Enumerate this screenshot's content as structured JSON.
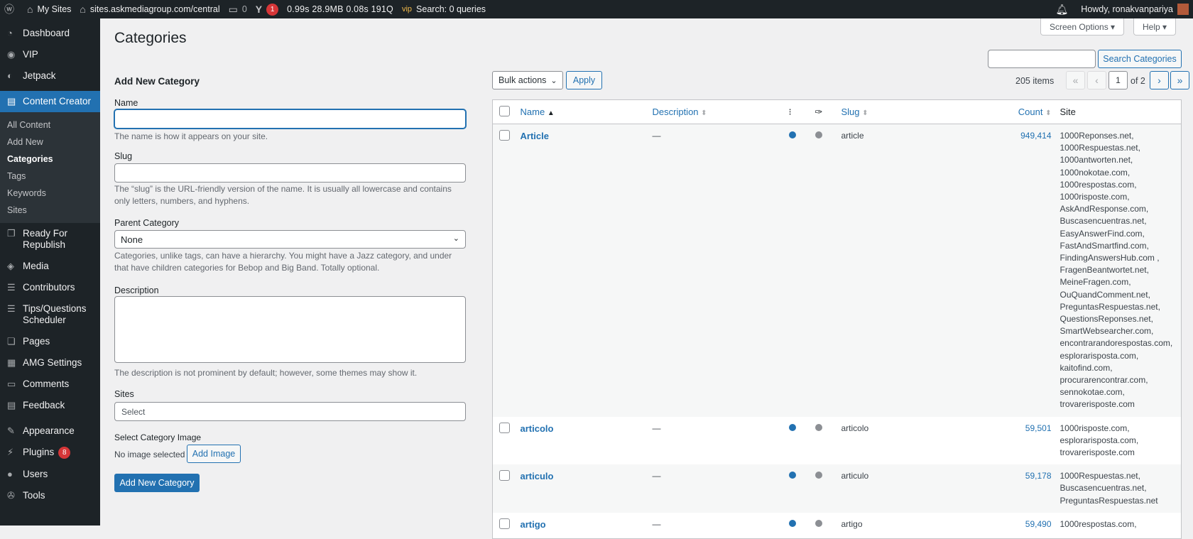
{
  "admin_bar": {
    "my_sites": "My Sites",
    "site_url": "sites.askmediagroup.com/central",
    "comments_count": "0",
    "yoast_count": "1",
    "perf": "0.99s  28.9MB  0.08s  191Q",
    "vip_search": "Search: 0 queries",
    "greeting": "Howdy, ronakvanpariya"
  },
  "sidebar": {
    "items_top": [
      "Dashboard",
      "VIP",
      "Jetpack"
    ],
    "active": "Content Creator",
    "submenu": [
      "All Content",
      "Add New",
      "Categories",
      "Tags",
      "Keywords",
      "Sites"
    ],
    "items_bottom": [
      "Ready For Republish",
      "Media",
      "Contributors",
      "Tips/Questions Scheduler",
      "Pages",
      "AMG Settings",
      "Comments",
      "Feedback",
      "Appearance",
      "Plugins",
      "Users",
      "Tools"
    ],
    "plugins_badge": "8"
  },
  "page": {
    "title": "Categories",
    "screen_options": "Screen Options ▾",
    "help": "Help ▾",
    "search_button": "Search Categories"
  },
  "form": {
    "heading": "Add New Category",
    "name_label": "Name",
    "name_help": "The name is how it appears on your site.",
    "slug_label": "Slug",
    "slug_help": "The “slug” is the URL-friendly version of the name. It is usually all lowercase and contains only letters, numbers, and hyphens.",
    "parent_label": "Parent Category",
    "parent_value": "None",
    "parent_help": "Categories, unlike tags, can have a hierarchy. You might have a Jazz category, and under that have children categories for Bebop and Big Band. Totally optional.",
    "desc_label": "Description",
    "desc_help": "The description is not prominent by default; however, some themes may show it.",
    "sites_label": "Sites",
    "sites_placeholder": "Select",
    "image_label": "Select Category Image",
    "no_image": "No image selected",
    "add_image": "Add Image",
    "submit": "Add New Category"
  },
  "list": {
    "bulk_actions": "Bulk actions",
    "apply": "Apply",
    "items_count": "205 items",
    "current_page": "1",
    "of_pages": "of 2",
    "columns": [
      "Name",
      "Description",
      "Slug",
      "Count",
      "Site"
    ],
    "rows": [
      {
        "name": "Article",
        "desc": "—",
        "slug": "article",
        "count": "949,414",
        "sites": [
          "1000Reponses.net,",
          "1000Respuestas.net,",
          "1000antworten.net,",
          "1000nokotae.com,",
          "1000respostas.com,",
          "1000risposte.com,",
          "AskAndResponse.com,",
          "Buscasencuentras.net,",
          "EasyAnswerFind.com,",
          "FastAndSmartfind.com,",
          "FindingAnswersHub.com ,",
          "FragenBeantwortet.net,",
          "MeineFragen.com,",
          "OuQuandComment.net,",
          "PreguntasRespuestas.net,",
          "QuestionsReponses.net,",
          "SmartWebsearcher.com,",
          "encontrarandorespostas.com,",
          "esplorarisposta.com,",
          "kaitofind.com,",
          "procurarencontrar.com,",
          "sennokotae.com,",
          "trovarerisposte.com"
        ]
      },
      {
        "name": "articolo",
        "desc": "—",
        "slug": "articolo",
        "count": "59,501",
        "sites": [
          "1000risposte.com,",
          "esplorarisposta.com,",
          "trovarerisposte.com"
        ]
      },
      {
        "name": "articulo",
        "desc": "—",
        "slug": "articulo",
        "count": "59,178",
        "sites": [
          "1000Respuestas.net,",
          "Buscasencuentras.net,",
          "PreguntasRespuestas.net"
        ]
      },
      {
        "name": "artigo",
        "desc": "—",
        "slug": "artigo",
        "count": "59,490",
        "sites": [
          "1000respostas.com,"
        ]
      }
    ]
  },
  "colors": {
    "accent": "#2271b1",
    "dot_blue": "#2271b1",
    "dot_gray": "#8c8f94"
  }
}
